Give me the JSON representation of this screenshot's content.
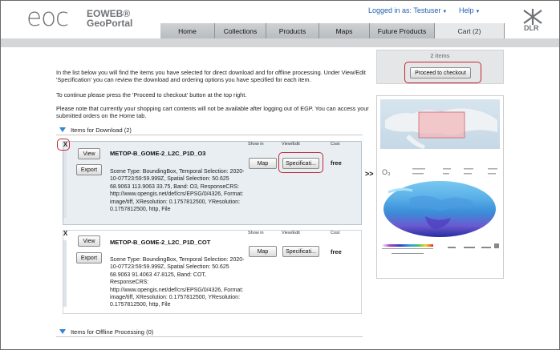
{
  "header": {
    "logo_text": "eoc",
    "logo_sub1": "EOWEB®",
    "logo_sub2": "GeoPortal",
    "logged_in": "Logged in as: Testuser",
    "help": "Help",
    "dlr": "DLR"
  },
  "tabs": [
    {
      "label": "Home"
    },
    {
      "label": "Collections"
    },
    {
      "label": "Products"
    },
    {
      "label": "Maps"
    },
    {
      "label": "Future Products"
    },
    {
      "label": "Cart (2)"
    }
  ],
  "intro": {
    "p1": "In the list below you will find the items you have selected for direct download and for offline processing. Under View/Edit 'Specification' you can review the download and ordering options you have specified for each item.",
    "p2": "To continue please press the 'Proceed to checkout' button at the top right.",
    "p3": "Please note that currently your shopping cart contents will not be available after logging out of EGP. You can access your submitted orders on the Home tab."
  },
  "sections": {
    "download": "Items for Download (2)",
    "offline": "Items for Offline Processing (0)"
  },
  "columns": {
    "show_in": "Show in",
    "view_edit": "View/Edit",
    "cost": "Cost"
  },
  "items": [
    {
      "remove": "X",
      "view": "View",
      "export": "Export",
      "title": "METOP-B_GOME-2_L2C_P1D_O3",
      "map": "Map",
      "spec": "Specificati...",
      "cost": "free",
      "desc": "Scene Type: BoundingBox, Temporal Selection: 2020-10-07T23:59:59.999Z, Spatial Selection: 50.625 68.9063 113.9063 33.75, Band: O3, ResponseCRS: http://www.opengis.net/def/crs/EPSG/0/4326, Format: image/tiff, XResolution: 0.1757812500, YResolution: 0.1757812500, http, File"
    },
    {
      "remove": "X",
      "view": "View",
      "export": "Export",
      "title": "METOP-B_GOME-2_L2C_P1D_COT",
      "map": "Map",
      "spec": "Specificati...",
      "cost": "free",
      "desc": "Scene Type: BoundingBox, Temporal Selection: 2020-10-07T23:59:59.999Z, Spatial Selection: 50.625 68.9063 91.4063 47.8125, Band: COT, ResponseCRS: http://www.opengis.net/def/crs/EPSG/0/4326, Format: image/tiff, XResolution: 0.1757812500, YResolution: 0.1757812500, http, File"
    }
  ],
  "cart": {
    "count": "2 items",
    "checkout": "Proceed to checkout",
    "arrows": ">>",
    "preview_symbol": "O₃"
  },
  "colors": {
    "accent_blue": "#2e86d4",
    "highlight_red": "#c4262e",
    "tab_active": "#e7e8e9"
  }
}
